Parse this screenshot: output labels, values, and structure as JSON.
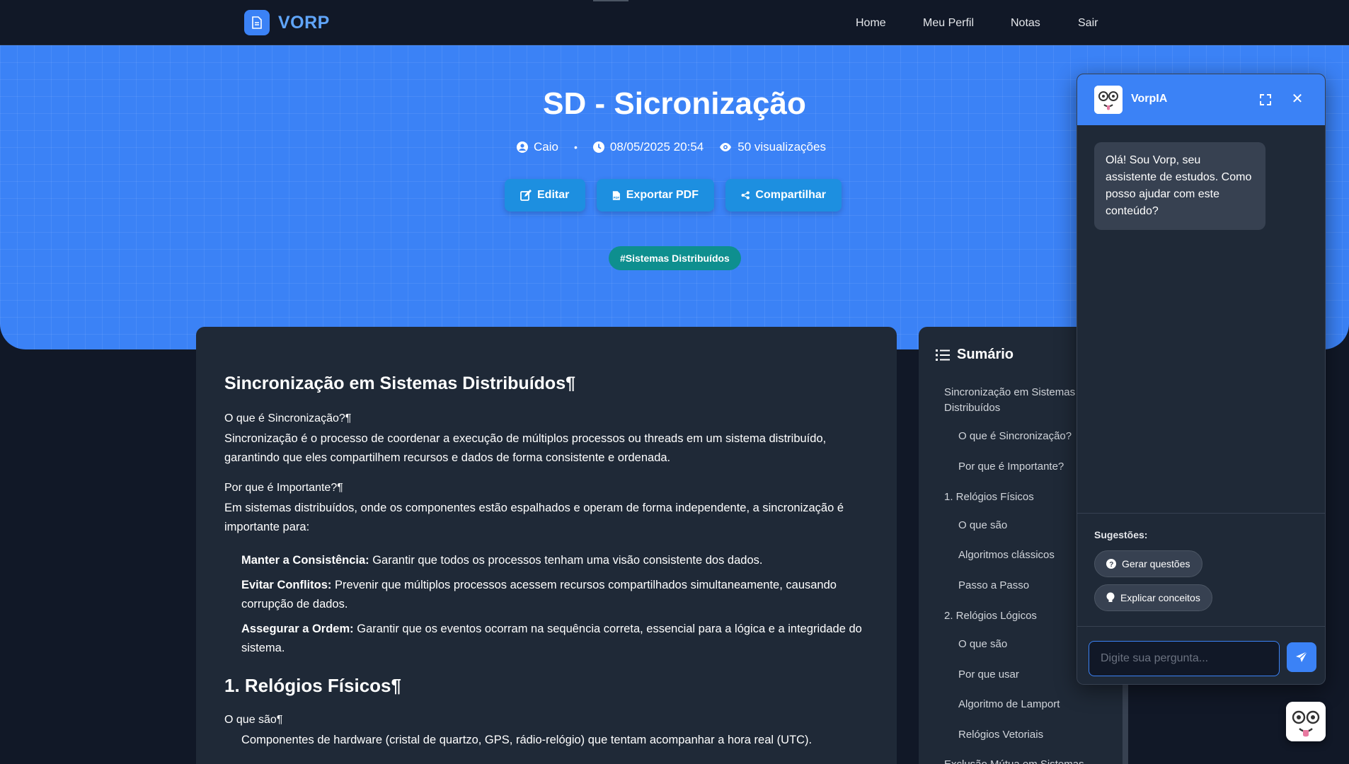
{
  "nav": {
    "brand": "VORP",
    "links": [
      "Home",
      "Meu Perfil",
      "Notas",
      "Sair"
    ]
  },
  "hero": {
    "title": "SD - Sicronização",
    "author": "Caio",
    "date": "08/05/2025 20:54",
    "views": "50 visualizações",
    "actions": {
      "edit": "Editar",
      "pdf": "Exportar PDF",
      "share": "Compartilhar"
    },
    "tag": "#Sistemas Distribuídos"
  },
  "content": {
    "h1": "Sincronização em Sistemas Distribuídos¶",
    "s1_title": "O que é Sincronização?¶",
    "s1_text": "Sincronização é o processo de coordenar a execução de múltiplos processos ou threads em um sistema distribuído, garantindo que eles compartilhem recursos e dados de forma consistente e ordenada.",
    "s2_title": "Por que é Importante?¶",
    "s2_text": "Em sistemas distribuídos, onde os componentes estão espalhados e operam de forma independente, a sincronização é importante para:",
    "bullets": [
      {
        "bold": "Manter a Consistência:",
        "text": " Garantir que todos os processos tenham uma visão consistente dos dados."
      },
      {
        "bold": "Evitar Conflitos:",
        "text": " Prevenir que múltiplos processos acessem recursos compartilhados simultaneamente, causando corrupção de dados."
      },
      {
        "bold": "Assegurar a Ordem:",
        "text": " Garantir que os eventos ocorram na sequência correta, essencial para a lógica e a integridade do sistema."
      }
    ],
    "h2": "1. Relógios Físicos¶",
    "s3_title": "O que são¶",
    "s3_text": "Componentes de hardware (cristal de quartzo, GPS, rádio-relógio) que tentam acompanhar a hora real (UTC)."
  },
  "toc": {
    "title": "Sumário",
    "items": [
      {
        "label": "Sincronização em Sistemas Distribuídos",
        "level": 1
      },
      {
        "label": "O que é Sincronização?",
        "level": 2
      },
      {
        "label": "Por que é Importante?",
        "level": 2
      },
      {
        "label": "1. Relógios Físicos",
        "level": 1
      },
      {
        "label": "O que são",
        "level": 2
      },
      {
        "label": "Algoritmos clássicos",
        "level": 2
      },
      {
        "label": "Passo a Passo",
        "level": 2
      },
      {
        "label": "2. Relógios Lógicos",
        "level": 1
      },
      {
        "label": "O que são",
        "level": 2
      },
      {
        "label": "Por que usar",
        "level": 2
      },
      {
        "label": "Algoritmo de Lamport",
        "level": 2
      },
      {
        "label": "Relógios Vetoriais",
        "level": 2
      },
      {
        "label": "Exclusão Mútua em Sistemas",
        "level": 1
      }
    ]
  },
  "chat": {
    "name": "VorpIA",
    "greeting": "Olá! Sou Vorp, seu assistente de estudos. Como posso ajudar com este conteúdo?",
    "suggestions_label": "Sugestões:",
    "suggestions": [
      "Gerar questões",
      "Explicar conceitos"
    ],
    "input_placeholder": "Digite sua pergunta..."
  },
  "colors": {
    "accent": "#3b82f6",
    "background": "#111827",
    "card": "#1f2937",
    "tag": "#0e8f8f"
  }
}
